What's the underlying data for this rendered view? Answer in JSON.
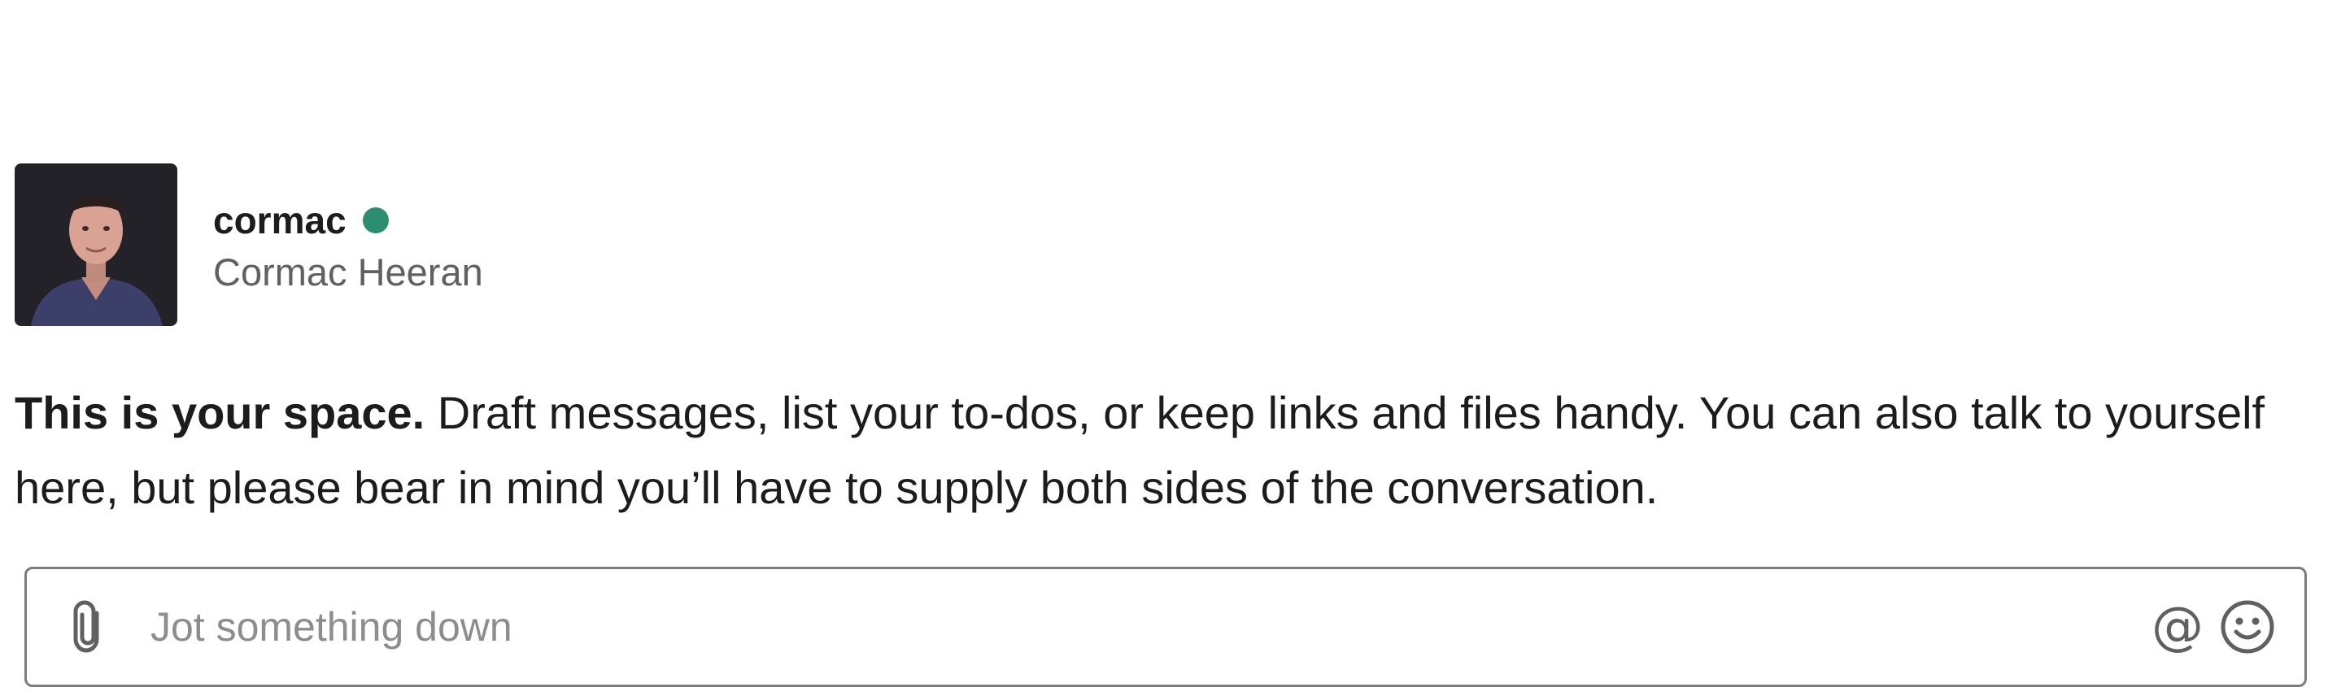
{
  "profile": {
    "handle": "cormac",
    "full_name": "Cormac Heeran",
    "presence": "active",
    "presence_color": "#2b8e6e",
    "avatar_icon": "user-photo"
  },
  "intro": {
    "bold_text": "This is your space.",
    "body_text": "Draft messages, list your to-dos, or keep links and files handy. You can also talk to yourself here, but please bear in mind you’ll have to supply both sides of the conversation."
  },
  "composer": {
    "placeholder": "Jot something down",
    "value": "",
    "attach_icon": "paperclip-icon",
    "mention_icon": "at-sign-icon",
    "mention_glyph": "@",
    "emoji_icon": "smiley-icon"
  }
}
